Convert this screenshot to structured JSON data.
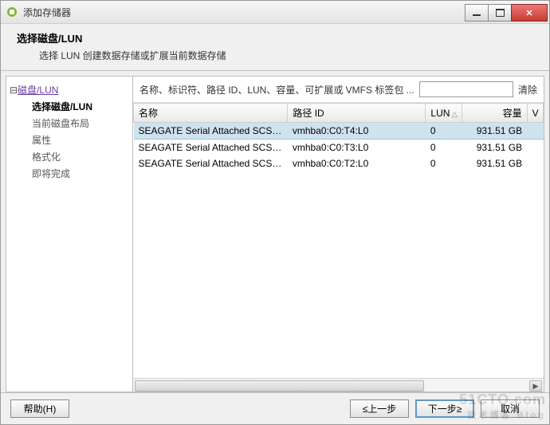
{
  "window": {
    "title": "添加存储器"
  },
  "header": {
    "title": "选择磁盘/LUN",
    "subtitle": "选择 LUN 创建数据存储或扩展当前数据存储"
  },
  "nav": {
    "root": "磁盘/LUN",
    "items": [
      {
        "label": "选择磁盘/LUN",
        "selected": true
      },
      {
        "label": "当前磁盘布局",
        "selected": false
      },
      {
        "label": "属性",
        "selected": false
      },
      {
        "label": "格式化",
        "selected": false
      },
      {
        "label": "即将完成",
        "selected": false
      }
    ]
  },
  "filter": {
    "label": "名称、标识符、路径 ID、LUN、容量、可扩展或 VMFS 标签包 ...",
    "value": "",
    "clear": "清除"
  },
  "table": {
    "columns": {
      "name": "名称",
      "path": "路径 ID",
      "lun": "LUN",
      "capacity": "容量",
      "v": "V"
    },
    "rows": [
      {
        "name": "SEAGATE Serial Attached SCSI Disk ...",
        "path": "vmhba0:C0:T4:L0",
        "lun": "0",
        "capacity": "931.51 GB",
        "selected": true
      },
      {
        "name": "SEAGATE Serial Attached SCSI Disk ...",
        "path": "vmhba0:C0:T3:L0",
        "lun": "0",
        "capacity": "931.51 GB",
        "selected": false
      },
      {
        "name": "SEAGATE Serial Attached SCSI Disk ...",
        "path": "vmhba0:C0:T2:L0",
        "lun": "0",
        "capacity": "931.51 GB",
        "selected": false
      }
    ]
  },
  "footer": {
    "help": "帮助(H)",
    "back": "≤上一步",
    "next": "下一步≥",
    "cancel": "取消"
  },
  "watermark": {
    "line1": "51CTO.com",
    "line2": "技术博客 Blog"
  }
}
